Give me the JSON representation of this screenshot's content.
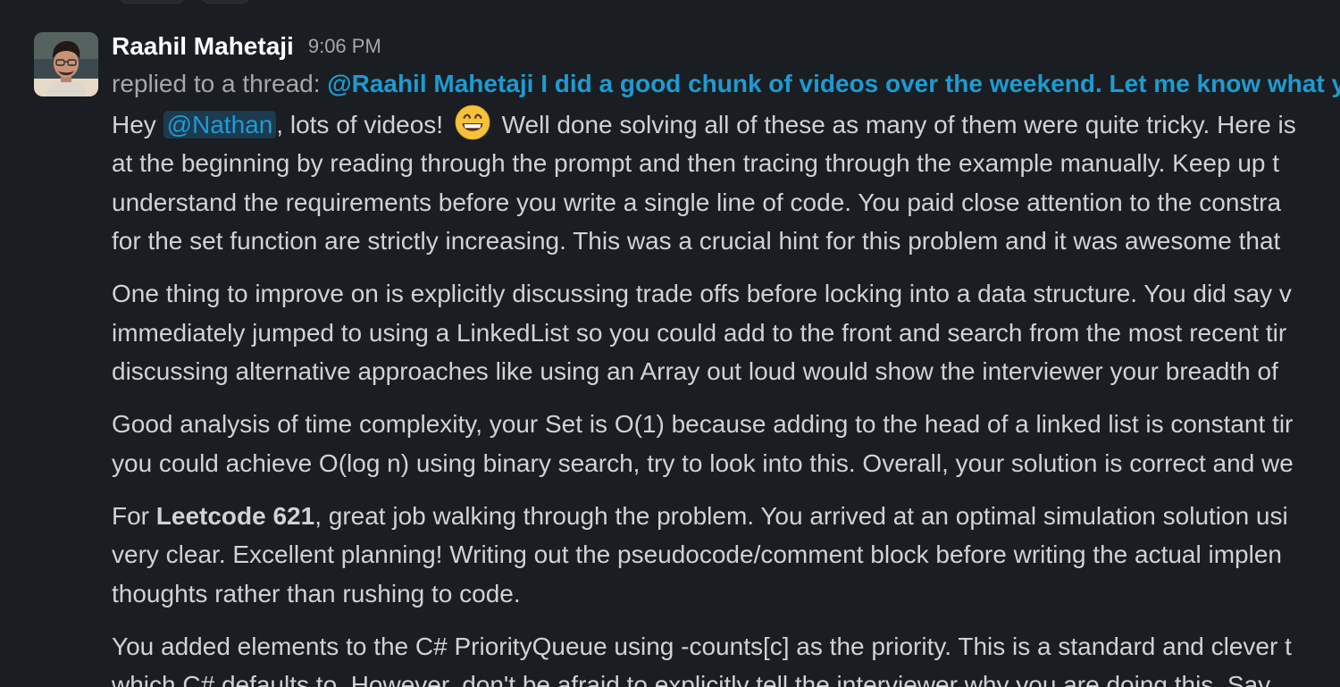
{
  "message": {
    "sender": "Raahil Mahetaji",
    "time": "9:06 PM",
    "thread_prefix": "replied to a thread: ",
    "thread_link": "@Raahil Mahetaji I did a good chunk of videos over the weekend. Let me know what y",
    "p1": {
      "l1_a": "Hey ",
      "mention": "@Nathan",
      "l1_b": ", lots of videos! ",
      "emoji": "grinning-face-emoji",
      "l1_c": " Well done solving all of these as many of them were quite tricky. Here is",
      "l2": "at the beginning by reading through the prompt and then tracing through the example manually. Keep up t",
      "l3": "understand the requirements before you write a single line of code. You paid close attention to the constra",
      "l4": "for the set function are strictly increasing. This was a crucial hint for this problem and it was awesome that"
    },
    "p2": {
      "l1": "One thing to improve on is explicitly discussing trade offs before locking into a data structure. You did say v",
      "l2": "immediately jumped to using a LinkedList so you could add to the front and search from the most recent tir",
      "l3": "discussing alternative approaches like using an Array out loud would show the interviewer your breadth of"
    },
    "p3": {
      "l1": "Good analysis of time complexity, your Set is O(1) because adding to the head of a linked list is constant tir",
      "l2": "you could achieve O(log n) using binary search, try to look into this. Overall, your solution is correct and we"
    },
    "p4": {
      "l1_a": "For ",
      "l1_bold": "Leetcode 621",
      "l1_b": ", great job walking through the problem. You arrived at an optimal simulation solution usi",
      "l2": "very clear. Excellent planning! Writing out the pseudocode/comment block before writing the actual implen",
      "l3": "thoughts rather than rushing to code."
    },
    "p5": {
      "l1": "You added elements to the C# PriorityQueue using -counts[c] as the priority. This is a standard and clever t",
      "l2": "which C# defaults to. However, don't be afraid to explicitly tell the interviewer why you are doing this. Say"
    }
  },
  "colors": {
    "background": "#1a1d21",
    "text": "#d1d2d3",
    "muted": "#a6a7a9",
    "link": "#1d9bd1",
    "mention_bg": "#1d3a4e"
  }
}
